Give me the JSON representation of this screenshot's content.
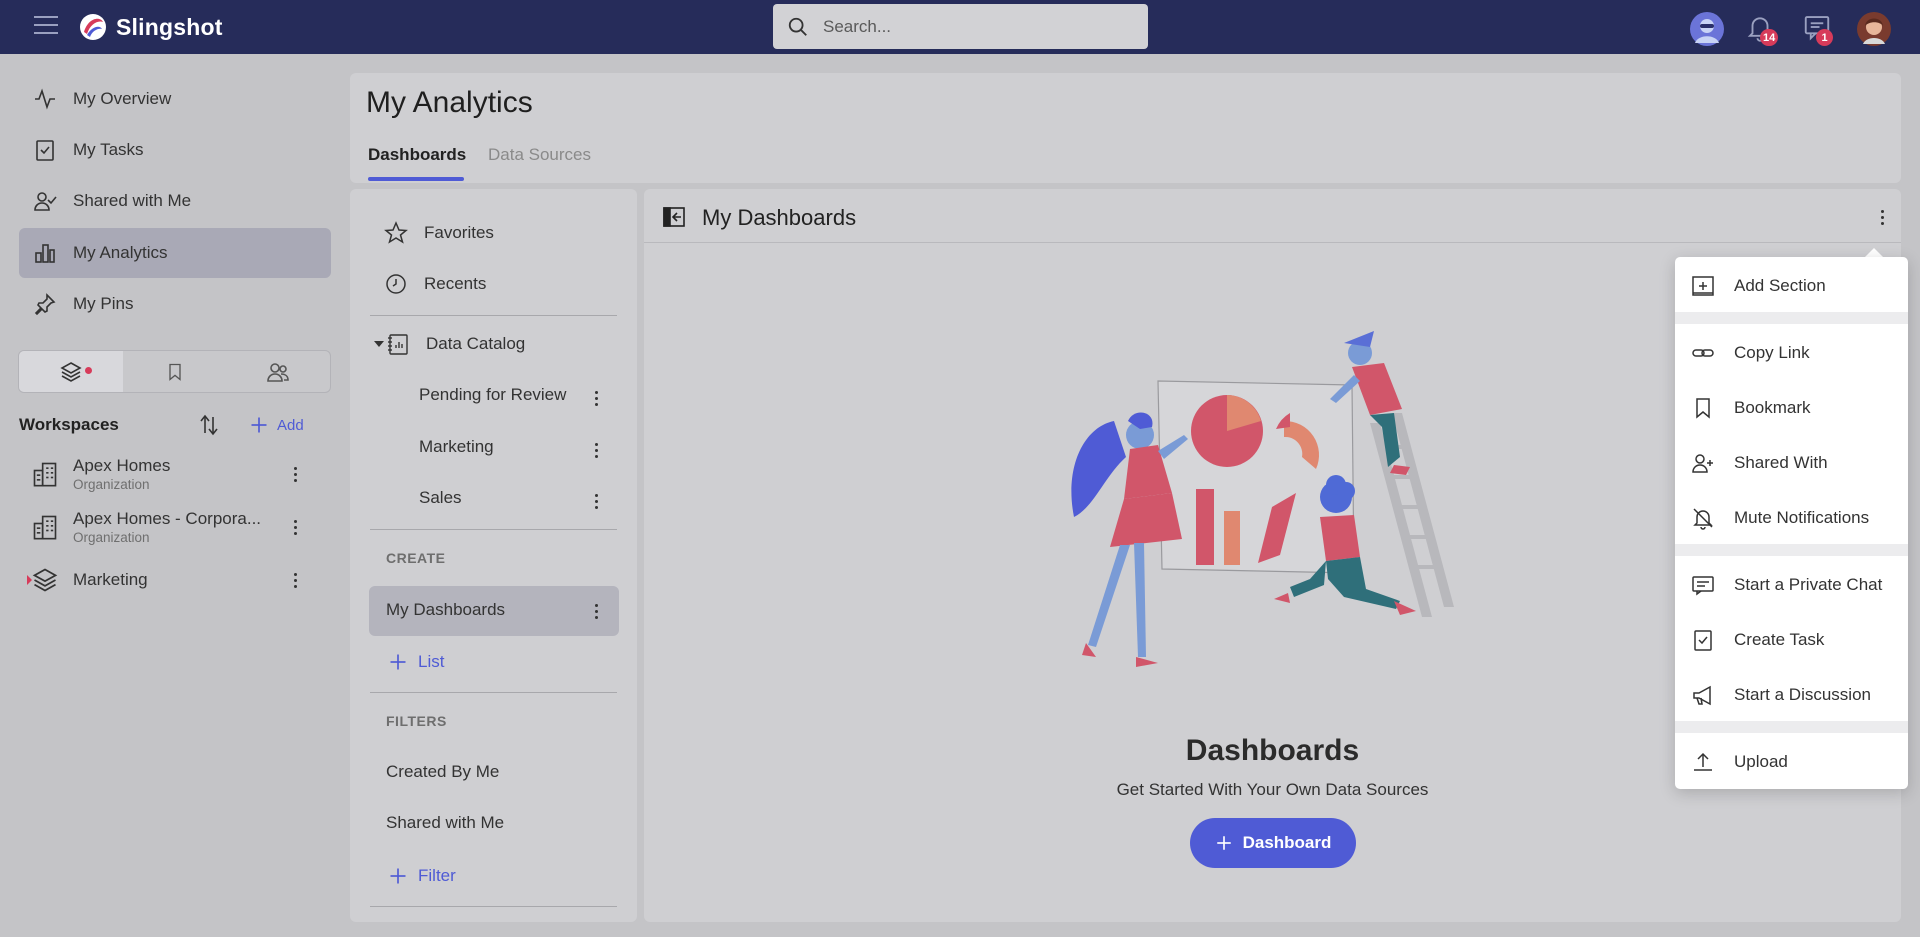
{
  "app": {
    "name": "Slingshot",
    "search_placeholder": "Search...",
    "notifications_count": "14",
    "messages_count": "1"
  },
  "sidebar": {
    "items": [
      {
        "label": "My Overview",
        "icon": "activity-icon"
      },
      {
        "label": "My Tasks",
        "icon": "task-check-icon"
      },
      {
        "label": "Shared with Me",
        "icon": "user-check-icon"
      },
      {
        "label": "My Analytics",
        "icon": "bar-chart-icon",
        "active": true
      },
      {
        "label": "My Pins",
        "icon": "pin-icon"
      }
    ],
    "workspaces_title": "Workspaces",
    "add_label": "Add",
    "workspaces": [
      {
        "name": "Apex Homes",
        "type": "Organization"
      },
      {
        "name": "Apex Homes - Corpora...",
        "type": "Organization"
      },
      {
        "name": "Marketing",
        "type": ""
      }
    ]
  },
  "header": {
    "title": "My Analytics",
    "tabs": [
      {
        "label": "Dashboards",
        "active": true
      },
      {
        "label": "Data Sources",
        "active": false
      }
    ]
  },
  "middle": {
    "favorites": "Favorites",
    "recents": "Recents",
    "data_catalog": "Data Catalog",
    "catalog_items": [
      "Pending for Review",
      "Marketing",
      "Sales"
    ],
    "create_section": "CREATE",
    "my_dashboards": "My Dashboards",
    "add_list": "List",
    "filters_section": "FILTERS",
    "filters": [
      "Created By Me",
      "Shared with Me"
    ],
    "add_filter": "Filter"
  },
  "main": {
    "title": "My Dashboards",
    "empty_title": "Dashboards",
    "empty_subtitle": "Get Started With Your Own Data Sources",
    "cta_label": "Dashboard"
  },
  "menu": {
    "items": [
      {
        "label": "Add Section",
        "icon": "add-section-icon"
      },
      {
        "label": "Copy Link",
        "icon": "link-icon"
      },
      {
        "label": "Bookmark",
        "icon": "bookmark-icon"
      },
      {
        "label": "Shared With",
        "icon": "user-plus-icon"
      },
      {
        "label": "Mute Notifications",
        "icon": "bell-off-icon"
      },
      {
        "label": "Start a Private Chat",
        "icon": "chat-icon"
      },
      {
        "label": "Create Task",
        "icon": "clipboard-check-icon"
      },
      {
        "label": "Start a Discussion",
        "icon": "megaphone-icon"
      },
      {
        "label": "Upload",
        "icon": "upload-icon"
      }
    ]
  },
  "colors": {
    "topbar": "#262c5a",
    "accent": "#4f5bd5",
    "badge": "#d73b5a"
  }
}
